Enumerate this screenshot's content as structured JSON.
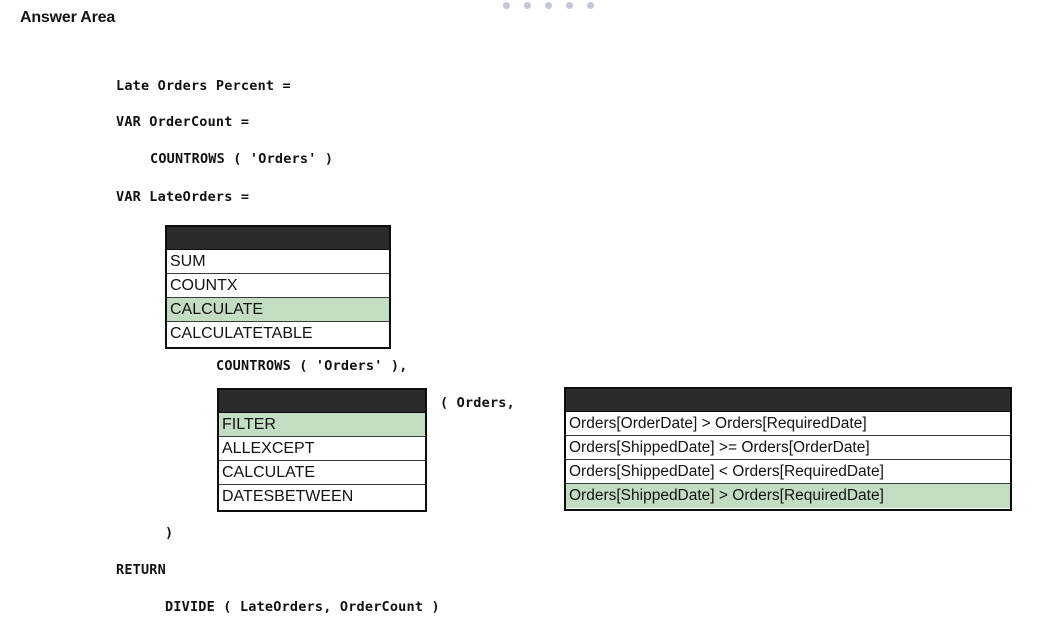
{
  "header": {
    "title": "Answer Area",
    "decorative_dots": [
      "dot",
      "dot",
      "dot",
      "dot",
      "dot"
    ]
  },
  "code": {
    "lines": [
      {
        "id": "line-measure-name",
        "text": "Late Orders Percent ="
      },
      {
        "id": "line-var-ordercount",
        "text": "VAR OrderCount ="
      },
      {
        "id": "line-countrows-orders",
        "text": "COUNTROWS ( 'Orders' )"
      },
      {
        "id": "line-var-lateorders",
        "text": "VAR LateOrders ="
      },
      {
        "id": "line-countrows-orders-comma",
        "text": "COUNTROWS ( 'Orders' ),"
      },
      {
        "id": "line-open-paren-orders",
        "text": "( Orders,"
      },
      {
        "id": "line-close-paren",
        "text": ")"
      },
      {
        "id": "line-return",
        "text": "RETURN"
      },
      {
        "id": "line-divide",
        "text": "DIVIDE ( LateOrders, OrderCount )"
      }
    ]
  },
  "dropdowns": [
    {
      "name": "dropdown-function-1",
      "selected": "CALCULATE",
      "options": [
        {
          "label": "SUM",
          "selected": false
        },
        {
          "label": "COUNTX",
          "selected": false
        },
        {
          "label": "CALCULATE",
          "selected": true
        },
        {
          "label": "CALCULATETABLE",
          "selected": false
        }
      ]
    },
    {
      "name": "dropdown-function-2",
      "selected": "FILTER",
      "options": [
        {
          "label": "FILTER",
          "selected": true
        },
        {
          "label": "ALLEXCEPT",
          "selected": false
        },
        {
          "label": "CALCULATE",
          "selected": false
        },
        {
          "label": "DATESBETWEEN",
          "selected": false
        }
      ]
    },
    {
      "name": "dropdown-condition",
      "selected": "Orders[ShippedDate] > Orders[RequiredDate]",
      "options": [
        {
          "label": "Orders[OrderDate] > Orders[RequiredDate]",
          "selected": false
        },
        {
          "label": "Orders[ShippedDate] >= Orders[OrderDate]",
          "selected": false
        },
        {
          "label": "Orders[ShippedDate] < Orders[RequiredDate]",
          "selected": false
        },
        {
          "label": "Orders[ShippedDate] > Orders[RequiredDate]",
          "selected": true
        }
      ]
    }
  ],
  "colors": {
    "selected_highlight": "#c3ddc3",
    "dropdown_header": "#2b2b2b",
    "border": "#0d0d0d",
    "text": "#111111",
    "dot": "#b9bed2"
  }
}
